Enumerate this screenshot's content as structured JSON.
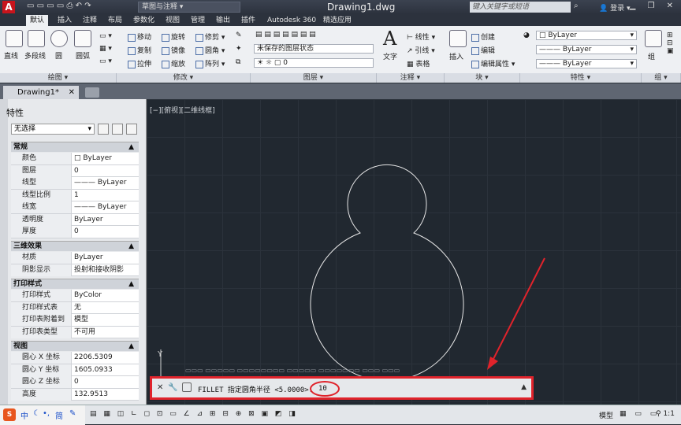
{
  "app": {
    "title": "Drawing1.dwg",
    "workspace": "草图与注释",
    "search_placeholder": "键入关键字或短语",
    "login": "登录"
  },
  "ribbon_tabs": [
    "默认",
    "插入",
    "注释",
    "布局",
    "参数化",
    "视图",
    "管理",
    "输出",
    "插件",
    "Autodesk 360",
    "精选应用"
  ],
  "ribbon": {
    "draw": {
      "title": "绘图",
      "items": [
        "直线",
        "多段线",
        "圆",
        "圆弧"
      ]
    },
    "modify": {
      "title": "修改",
      "items": [
        "移动",
        "旋转",
        "修剪",
        "复制",
        "镜像",
        "圆角",
        "拉伸",
        "缩放",
        "阵列"
      ]
    },
    "layers": {
      "title": "图层",
      "state": "未保存的图层状态",
      "current": "0"
    },
    "annotation": {
      "title": "注释",
      "text": "文字",
      "linear": "线性",
      "leader": "引线",
      "table": "表格"
    },
    "block": {
      "title": "块",
      "insert": "插入",
      "create": "创建",
      "edit": "编辑",
      "edit_attr": "编辑属性"
    },
    "properties": {
      "title": "特性",
      "color": "ByLayer",
      "linetype": "ByLayer",
      "lineweight": "ByLayer"
    },
    "group": {
      "title": "组",
      "label": "组"
    }
  },
  "doc_tab": "Drawing1*",
  "viewport_label": "[−][俯视][二维线框]",
  "properties": {
    "title": "特性",
    "selection": "无选择",
    "sections": [
      {
        "name": "常规",
        "rows": [
          [
            "颜色",
            "ByLayer"
          ],
          [
            "图层",
            "0"
          ],
          [
            "线型",
            "——— ByLayer"
          ],
          [
            "线型比例",
            "1"
          ],
          [
            "线宽",
            "——— ByLayer"
          ],
          [
            "透明度",
            "ByLayer"
          ],
          [
            "厚度",
            "0"
          ]
        ]
      },
      {
        "name": "三维效果",
        "rows": [
          [
            "材质",
            "ByLayer"
          ],
          [
            "阴影显示",
            "投射和接收阴影"
          ]
        ]
      },
      {
        "name": "打印样式",
        "rows": [
          [
            "打印样式",
            "ByColor"
          ],
          [
            "打印样式表",
            "无"
          ],
          [
            "打印表附着到",
            "模型"
          ],
          [
            "打印表类型",
            "不可用"
          ]
        ]
      },
      {
        "name": "视图",
        "rows": [
          [
            "圆心 X 坐标",
            "2206.5309"
          ],
          [
            "圆心 Y 坐标",
            "1605.0933"
          ],
          [
            "圆心 Z 坐标",
            "0"
          ],
          [
            "高度",
            "132.9513"
          ]
        ]
      }
    ]
  },
  "command": {
    "prompt": "FILLET 指定圆角半径 <5.0000>:",
    "value": "10"
  },
  "status": {
    "model": "模型",
    "scale": "1:1"
  },
  "ime": {
    "label": "中",
    "mode": "简"
  }
}
